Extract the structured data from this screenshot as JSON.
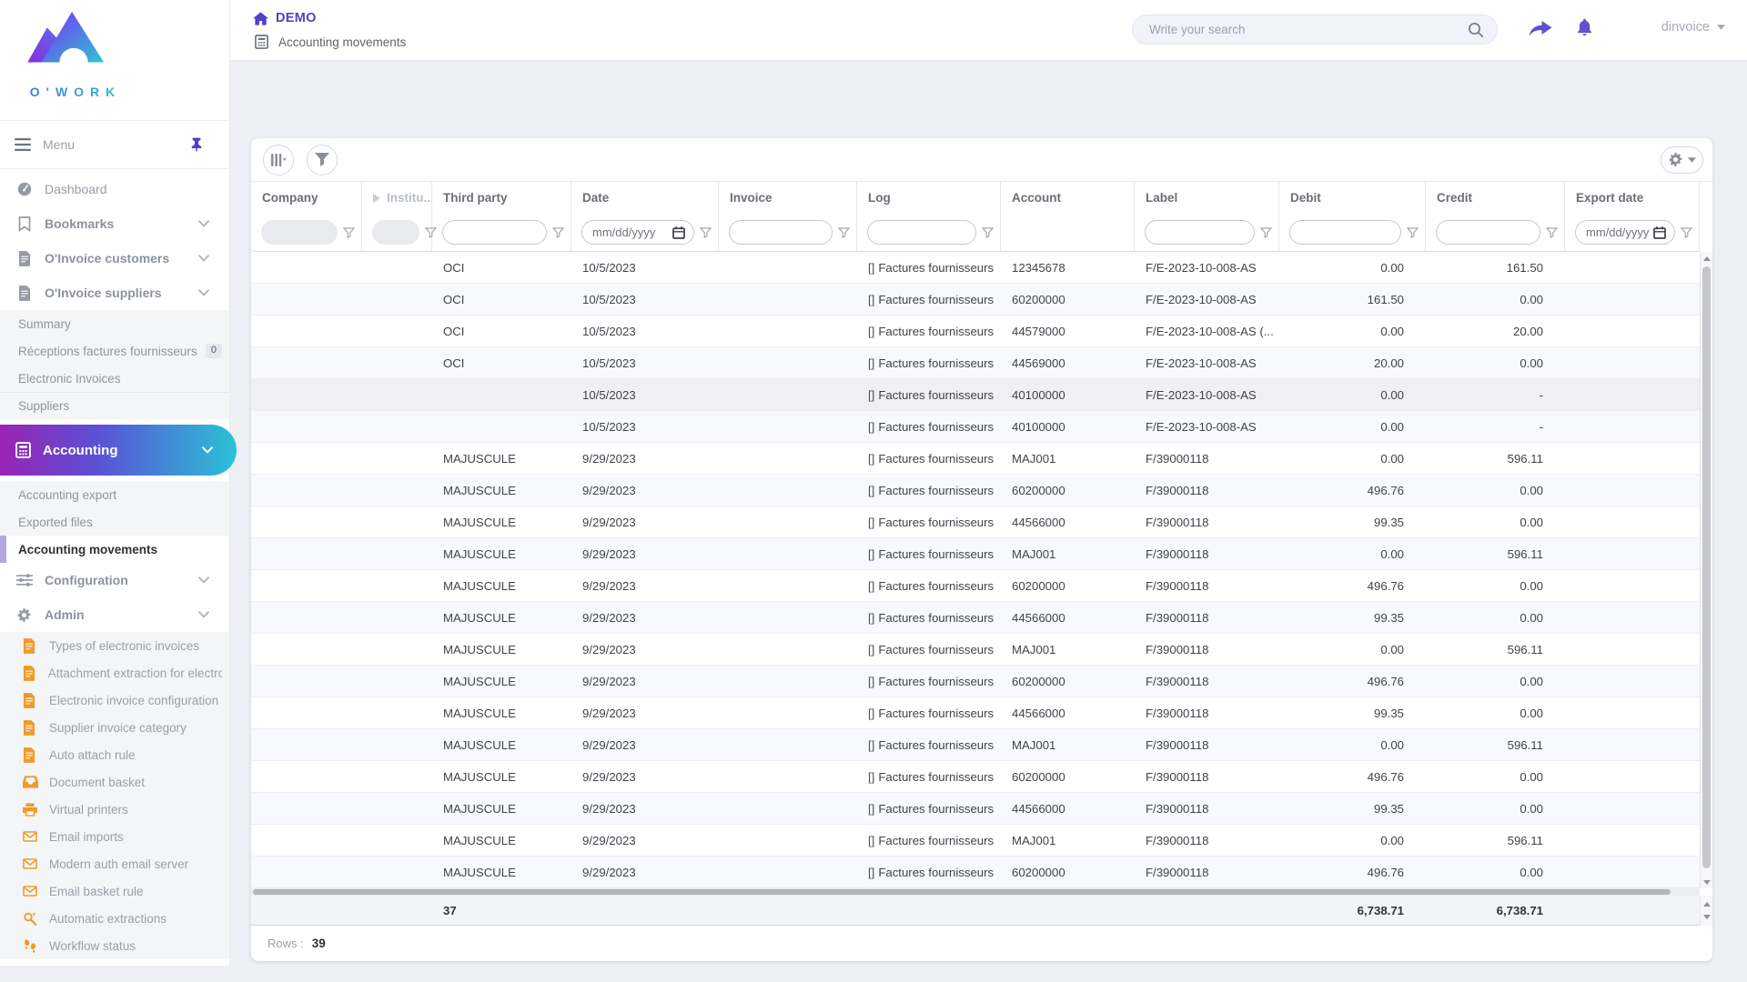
{
  "colors": {
    "accent": "#5040c8",
    "gradient_from": "#9a23b4",
    "gradient_to": "#2ac3d6",
    "admin_icon_orange": "#f09a28"
  },
  "brand": {
    "wordmark": "O'WORK"
  },
  "header": {
    "breadcrumb": "DEMO",
    "page_title": "Accounting movements",
    "search_placeholder": "Write your search",
    "username": "dinvoice"
  },
  "sidebar": {
    "menu_label": "Menu",
    "items": [
      {
        "label": "Dashboard",
        "icon": "dashboard"
      },
      {
        "label": "Bookmarks",
        "icon": "bookmark",
        "bold": true,
        "chevron": true
      },
      {
        "label": "O'Invoice customers",
        "icon": "invoice",
        "bold": true,
        "chevron": true
      },
      {
        "label": "O'Invoice suppliers",
        "icon": "invoice",
        "bold": true,
        "chevron": true,
        "children": [
          {
            "label": "Summary"
          },
          {
            "label": "Réceptions factures fournisseurs",
            "badge": "0"
          },
          {
            "label": "Electronic Invoices"
          },
          {
            "label": "Suppliers",
            "divider": true
          }
        ]
      },
      {
        "label": "Accounting",
        "icon": "calculator",
        "active": true,
        "chevron": true,
        "children": [
          {
            "label": "Accounting export"
          },
          {
            "label": "Exported files"
          },
          {
            "label": "Accounting movements",
            "current": true
          }
        ]
      },
      {
        "label": "Configuration",
        "icon": "sliders",
        "bold": true,
        "chevron": true
      },
      {
        "label": "Admin",
        "icon": "gear",
        "bold": true,
        "chevron": true,
        "children": [
          {
            "label": "Types of electronic invoices",
            "icon": "invoice"
          },
          {
            "label": "Attachment extraction for electroni",
            "icon": "invoice"
          },
          {
            "label": "Electronic invoice configuration",
            "icon": "invoice"
          },
          {
            "label": "Supplier invoice category",
            "icon": "invoice"
          },
          {
            "label": "Auto attach rule",
            "icon": "invoice"
          },
          {
            "label": "Document basket",
            "icon": "tray"
          },
          {
            "label": "Virtual printers",
            "icon": "printer"
          },
          {
            "label": "Email imports",
            "icon": "mail"
          },
          {
            "label": "Modern auth email server",
            "icon": "mail"
          },
          {
            "label": "Email basket rule",
            "icon": "mail"
          },
          {
            "label": "Automatic extractions",
            "icon": "wand"
          },
          {
            "label": "Workflow status",
            "icon": "footprints"
          }
        ]
      }
    ]
  },
  "table": {
    "columns": [
      {
        "label": "Company",
        "filter": "disabled"
      },
      {
        "label": "Institu...",
        "filter": "disabled",
        "dim": true
      },
      {
        "label": "Third party",
        "filter": "text"
      },
      {
        "label": "Date",
        "filter": "date"
      },
      {
        "label": "Invoice",
        "filter": "text"
      },
      {
        "label": "Log",
        "filter": "text"
      },
      {
        "label": "Account",
        "filter": "none"
      },
      {
        "label": "Label",
        "filter": "text"
      },
      {
        "label": "Debit",
        "filter": "text"
      },
      {
        "label": "Credit",
        "filter": "text"
      },
      {
        "label": "Export date",
        "filter": "date"
      }
    ],
    "date_placeholder": "mm/dd/yyyy",
    "log_prefix": "[]",
    "rows": [
      {
        "third_party": "OCI",
        "date": "10/5/2023",
        "log": "Factures fournisseurs",
        "account": "12345678",
        "label": "F/E-2023-10-008-AS",
        "debit": "0.00",
        "credit": "161.50"
      },
      {
        "third_party": "OCI",
        "date": "10/5/2023",
        "log": "Factures fournisseurs",
        "account": "60200000",
        "label": "F/E-2023-10-008-AS",
        "debit": "161.50",
        "credit": "0.00"
      },
      {
        "third_party": "OCI",
        "date": "10/5/2023",
        "log": "Factures fournisseurs",
        "account": "44579000",
        "label": "F/E-2023-10-008-AS (...",
        "debit": "0.00",
        "credit": "20.00"
      },
      {
        "third_party": "OCI",
        "date": "10/5/2023",
        "log": "Factures fournisseurs",
        "account": "44569000",
        "label": "F/E-2023-10-008-AS",
        "debit": "20.00",
        "credit": "0.00"
      },
      {
        "third_party": "",
        "date": "10/5/2023",
        "log": "Factures fournisseurs",
        "account": "40100000",
        "label": "F/E-2023-10-008-AS",
        "debit": "0.00",
        "credit": "-",
        "shade": "gray"
      },
      {
        "third_party": "",
        "date": "10/5/2023",
        "log": "Factures fournisseurs",
        "account": "40100000",
        "label": "F/E-2023-10-008-AS",
        "debit": "0.00",
        "credit": "-"
      },
      {
        "third_party": "MAJUSCULE",
        "date": "9/29/2023",
        "log": "Factures fournisseurs",
        "account": "MAJ001",
        "label": "F/39000118",
        "debit": "0.00",
        "credit": "596.11"
      },
      {
        "third_party": "MAJUSCULE",
        "date": "9/29/2023",
        "log": "Factures fournisseurs",
        "account": "60200000",
        "label": "F/39000118",
        "debit": "496.76",
        "credit": "0.00"
      },
      {
        "third_party": "MAJUSCULE",
        "date": "9/29/2023",
        "log": "Factures fournisseurs",
        "account": "44566000",
        "label": "F/39000118",
        "debit": "99.35",
        "credit": "0.00"
      },
      {
        "third_party": "MAJUSCULE",
        "date": "9/29/2023",
        "log": "Factures fournisseurs",
        "account": "MAJ001",
        "label": "F/39000118",
        "debit": "0.00",
        "credit": "596.11"
      },
      {
        "third_party": "MAJUSCULE",
        "date": "9/29/2023",
        "log": "Factures fournisseurs",
        "account": "60200000",
        "label": "F/39000118",
        "debit": "496.76",
        "credit": "0.00"
      },
      {
        "third_party": "MAJUSCULE",
        "date": "9/29/2023",
        "log": "Factures fournisseurs",
        "account": "44566000",
        "label": "F/39000118",
        "debit": "99.35",
        "credit": "0.00"
      },
      {
        "third_party": "MAJUSCULE",
        "date": "9/29/2023",
        "log": "Factures fournisseurs",
        "account": "MAJ001",
        "label": "F/39000118",
        "debit": "0.00",
        "credit": "596.11"
      },
      {
        "third_party": "MAJUSCULE",
        "date": "9/29/2023",
        "log": "Factures fournisseurs",
        "account": "60200000",
        "label": "F/39000118",
        "debit": "496.76",
        "credit": "0.00"
      },
      {
        "third_party": "MAJUSCULE",
        "date": "9/29/2023",
        "log": "Factures fournisseurs",
        "account": "44566000",
        "label": "F/39000118",
        "debit": "99.35",
        "credit": "0.00"
      },
      {
        "third_party": "MAJUSCULE",
        "date": "9/29/2023",
        "log": "Factures fournisseurs",
        "account": "MAJ001",
        "label": "F/39000118",
        "debit": "0.00",
        "credit": "596.11"
      },
      {
        "third_party": "MAJUSCULE",
        "date": "9/29/2023",
        "log": "Factures fournisseurs",
        "account": "60200000",
        "label": "F/39000118",
        "debit": "496.76",
        "credit": "0.00"
      },
      {
        "third_party": "MAJUSCULE",
        "date": "9/29/2023",
        "log": "Factures fournisseurs",
        "account": "44566000",
        "label": "F/39000118",
        "debit": "99.35",
        "credit": "0.00"
      },
      {
        "third_party": "MAJUSCULE",
        "date": "9/29/2023",
        "log": "Factures fournisseurs",
        "account": "MAJ001",
        "label": "F/39000118",
        "debit": "0.00",
        "credit": "596.11"
      },
      {
        "third_party": "MAJUSCULE",
        "date": "9/29/2023",
        "log": "Factures fournisseurs",
        "account": "60200000",
        "label": "F/39000118",
        "debit": "496.76",
        "credit": "0.00"
      }
    ],
    "totals": {
      "third_party": "37",
      "debit": "6,738.71",
      "credit": "6,738.71"
    },
    "rows_label": "Rows :",
    "rows_count": "39"
  }
}
